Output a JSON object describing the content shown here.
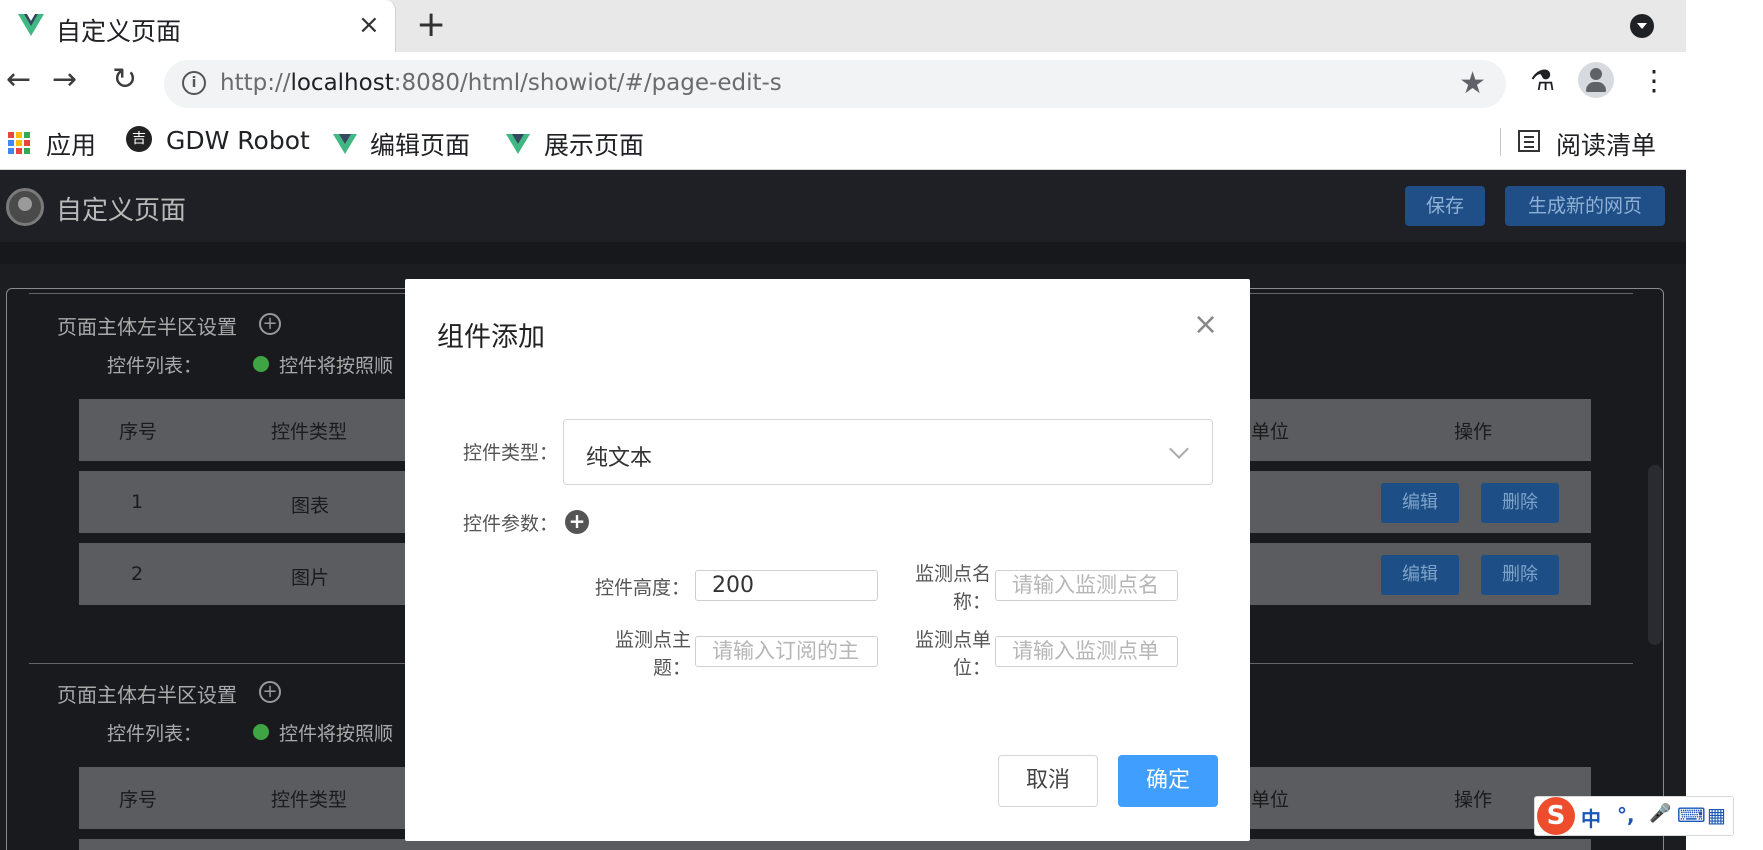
{
  "browser": {
    "tab_title": "自定义页面",
    "tab_close": "×",
    "new_tab": "+",
    "url_prefix": "http://",
    "url_host": "localhost",
    "url_rest": ":8080/html/showiot/#/page-edit-s",
    "info_glyph": "i",
    "nav": {
      "back": "←",
      "forward": "→",
      "reload": "↻",
      "star": "★",
      "lab": "⚗",
      "more": "⋮"
    },
    "bookmarks": [
      {
        "label": "应用",
        "icon": "apps-grid-icon"
      },
      {
        "label": "GDW Robot",
        "icon": "robot-icon"
      },
      {
        "label": "编辑页面",
        "icon": "vue-icon"
      },
      {
        "label": "展示页面",
        "icon": "vue-icon"
      }
    ],
    "robot_glyph": "吉",
    "reading_list": "阅读清单"
  },
  "app": {
    "title": "自定义页面",
    "buttons": {
      "save": "保存",
      "generate": "生成新的网页"
    },
    "left_section": {
      "title": "页面主体左半区设置",
      "list_label": "控件列表：",
      "hint": "控件将按照顺",
      "columns": [
        "序号",
        "控件类型",
        "单位",
        "操作"
      ],
      "rows": [
        {
          "index": "1",
          "type": "图表"
        },
        {
          "index": "2",
          "type": "图片"
        }
      ],
      "row_actions": {
        "edit": "编辑",
        "delete": "删除"
      }
    },
    "right_section": {
      "title": "页面主体右半区设置",
      "list_label": "控件列表：",
      "hint": "控件将按照顺",
      "columns": [
        "序号",
        "控件类型",
        "单位",
        "操作"
      ]
    },
    "plus_glyph": "+"
  },
  "modal": {
    "title": "组件添加",
    "close": "×",
    "type_label": "控件类型：",
    "type_value": "纯文本",
    "params_label": "控件参数：",
    "add_glyph": "+",
    "height_label": "控件高度：",
    "height_value": "200",
    "point_name_label_1": "监测点名",
    "point_name_label_2": "称：",
    "point_name_placeholder": "请输入监测点名",
    "topic_label_1": "监测点主",
    "topic_label_2": "题：",
    "topic_placeholder": "请输入订阅的主",
    "unit_label_1": "监测点单",
    "unit_label_2": "位：",
    "unit_placeholder": "请输入监测点单",
    "cancel": "取消",
    "confirm": "确定"
  },
  "ime": {
    "logo": "S",
    "mode": "中",
    "punct": "°,",
    "mic": "🎤",
    "keyboard": "⌨",
    "grid": "▦"
  }
}
